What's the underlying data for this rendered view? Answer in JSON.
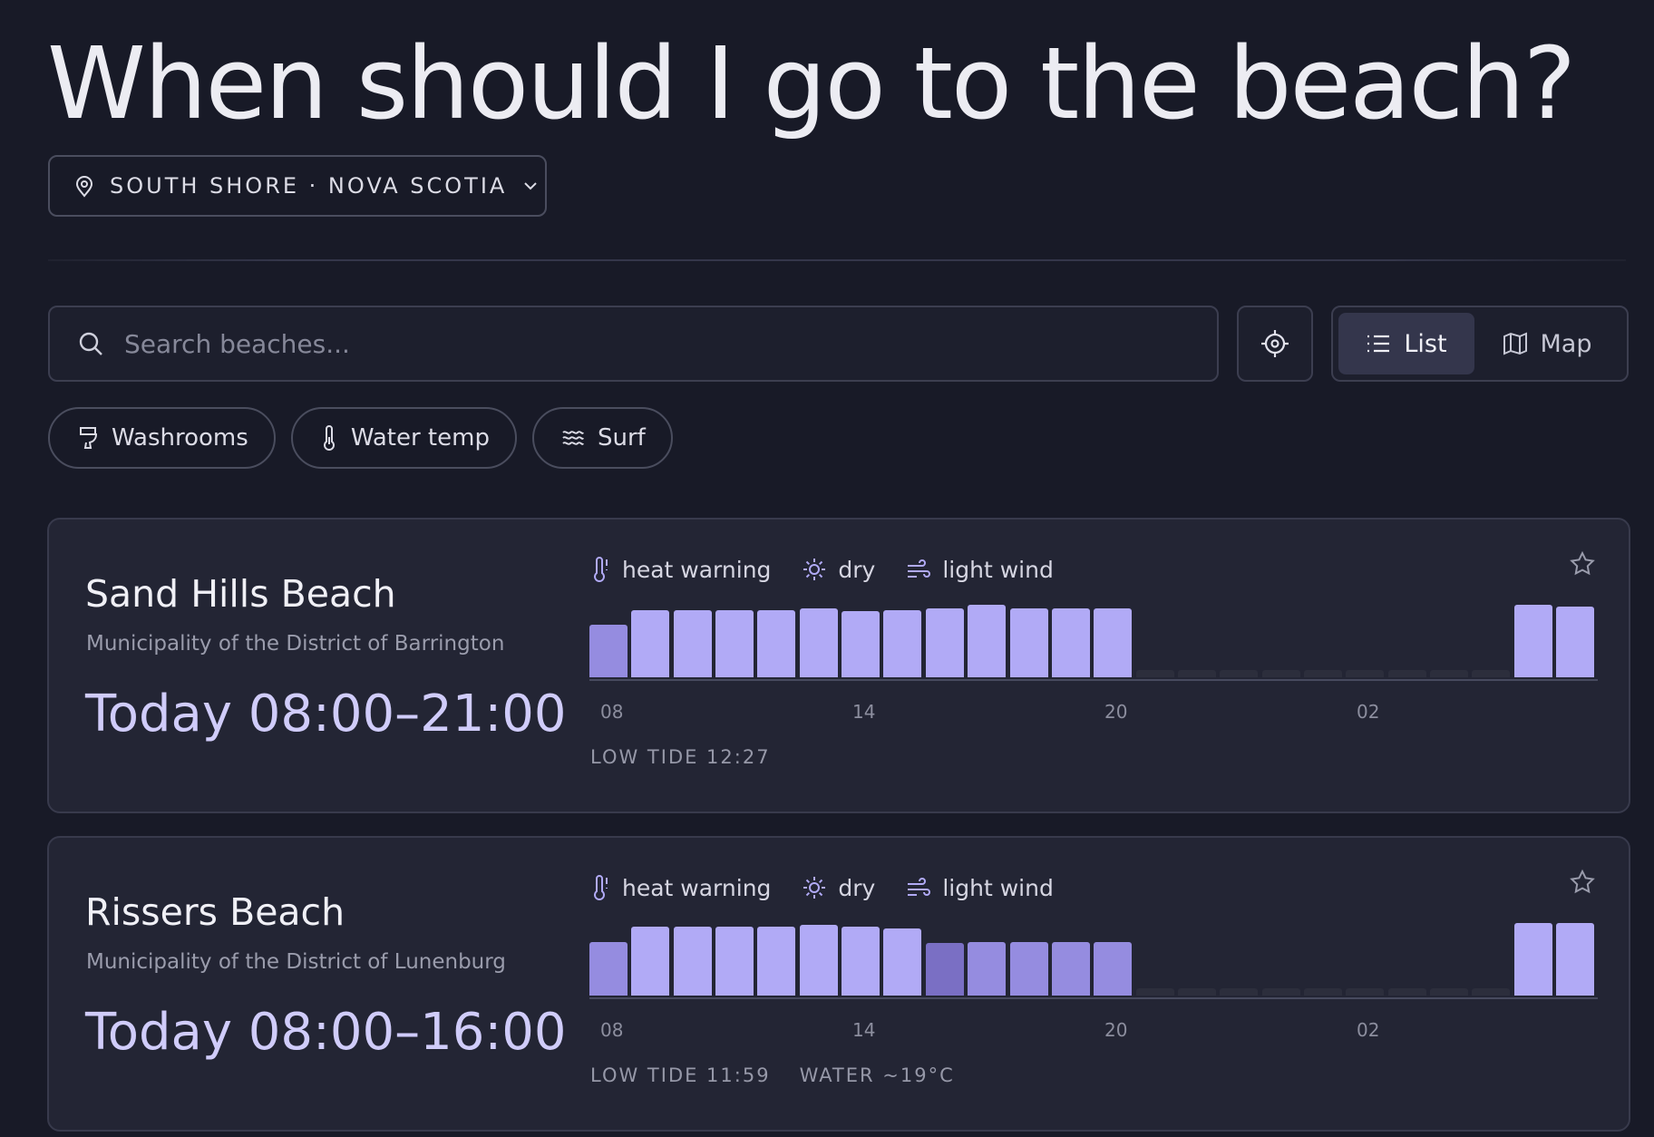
{
  "page": {
    "title": "When should I go to the beach?",
    "region": "SOUTH SHORE · NOVA SCOTIA"
  },
  "search": {
    "placeholder": "Search beaches..."
  },
  "view_toggle": {
    "list_label": "List",
    "map_label": "Map",
    "active": "list"
  },
  "filters": [
    {
      "label": "Washrooms",
      "icon": "toilet-icon"
    },
    {
      "label": "Water temp",
      "icon": "thermometer-icon"
    },
    {
      "label": "Surf",
      "icon": "waves-icon"
    }
  ],
  "colors": {
    "bar_good": "#b1aaf6",
    "bar_fair": "#958ce0",
    "bar_dim": "#7a6fc4",
    "bar_none": "#2c2e3c",
    "accent_text": "#d0ccfa"
  },
  "beaches": [
    {
      "name": "Sand Hills Beach",
      "municipality": "Municipality of the District of Barrington",
      "window": "Today 08:00–21:00",
      "tags": [
        {
          "label": "heat warning",
          "icon": "thermometer-alert-icon"
        },
        {
          "label": "dry",
          "icon": "sun-icon"
        },
        {
          "label": "light wind",
          "icon": "wind-icon"
        }
      ],
      "ticks": [
        "08",
        "14",
        "20",
        "02"
      ],
      "footer": [
        "LOW TIDE 12:27"
      ],
      "hourly": [
        {
          "level": "fair",
          "v": 0.72
        },
        {
          "level": "good",
          "v": 0.93
        },
        {
          "level": "good",
          "v": 0.93
        },
        {
          "level": "good",
          "v": 0.93
        },
        {
          "level": "good",
          "v": 0.93
        },
        {
          "level": "good",
          "v": 0.95
        },
        {
          "level": "good",
          "v": 0.91
        },
        {
          "level": "good",
          "v": 0.93
        },
        {
          "level": "good",
          "v": 0.95
        },
        {
          "level": "good",
          "v": 1.0
        },
        {
          "level": "good",
          "v": 0.95
        },
        {
          "level": "good",
          "v": 0.95
        },
        {
          "level": "good",
          "v": 0.95
        },
        {
          "level": "none",
          "v": 0.1
        },
        {
          "level": "none",
          "v": 0.1
        },
        {
          "level": "none",
          "v": 0.1
        },
        {
          "level": "none",
          "v": 0.1
        },
        {
          "level": "none",
          "v": 0.1
        },
        {
          "level": "none",
          "v": 0.1
        },
        {
          "level": "none",
          "v": 0.1
        },
        {
          "level": "none",
          "v": 0.1
        },
        {
          "level": "none",
          "v": 0.1
        },
        {
          "level": "good",
          "v": 1.0
        },
        {
          "level": "good",
          "v": 0.98
        }
      ]
    },
    {
      "name": "Rissers Beach",
      "municipality": "Municipality of the District of Lunenburg",
      "window": "Today 08:00–16:00",
      "tags": [
        {
          "label": "heat warning",
          "icon": "thermometer-alert-icon"
        },
        {
          "label": "dry",
          "icon": "sun-icon"
        },
        {
          "label": "light wind",
          "icon": "wind-icon"
        }
      ],
      "ticks": [
        "08",
        "14",
        "20",
        "02"
      ],
      "footer": [
        "LOW TIDE 11:59",
        "WATER ~19°C"
      ],
      "hourly": [
        {
          "level": "fair",
          "v": 0.74
        },
        {
          "level": "good",
          "v": 0.95
        },
        {
          "level": "good",
          "v": 0.95
        },
        {
          "level": "good",
          "v": 0.95
        },
        {
          "level": "good",
          "v": 0.95
        },
        {
          "level": "good",
          "v": 0.98
        },
        {
          "level": "good",
          "v": 0.95
        },
        {
          "level": "good",
          "v": 0.93
        },
        {
          "level": "dim",
          "v": 0.72
        },
        {
          "level": "fair",
          "v": 0.74
        },
        {
          "level": "fair",
          "v": 0.74
        },
        {
          "level": "fair",
          "v": 0.74
        },
        {
          "level": "fair",
          "v": 0.74
        },
        {
          "level": "none",
          "v": 0.1
        },
        {
          "level": "none",
          "v": 0.1
        },
        {
          "level": "none",
          "v": 0.1
        },
        {
          "level": "none",
          "v": 0.1
        },
        {
          "level": "none",
          "v": 0.1
        },
        {
          "level": "none",
          "v": 0.1
        },
        {
          "level": "none",
          "v": 0.1
        },
        {
          "level": "none",
          "v": 0.1
        },
        {
          "level": "none",
          "v": 0.1
        },
        {
          "level": "good",
          "v": 1.0
        },
        {
          "level": "good",
          "v": 1.0
        }
      ]
    }
  ]
}
